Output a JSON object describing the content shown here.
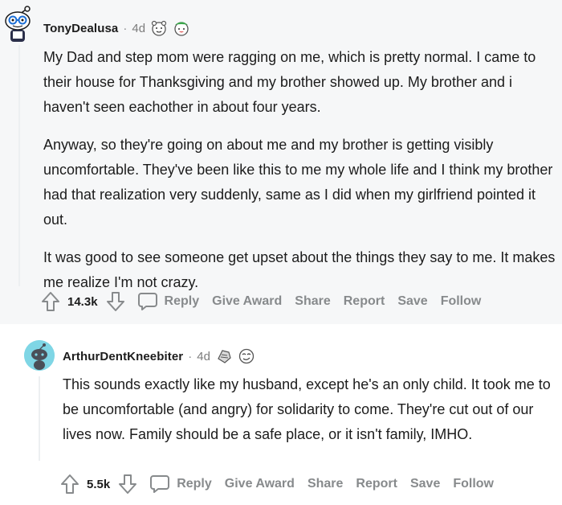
{
  "comments": [
    {
      "username": "TonyDealusa",
      "age": "4d",
      "paragraphs": [
        "My Dad and step mom were ragging on me, which is pretty normal. I came to their house for Thanksgiving and my brother showed up. My brother and i haven't seen eachother in about four years.",
        "Anyway, so they're going on about me and my brother is getting visibly uncomfortable. They've been like this to me my whole life and I think my brother had that realization very suddenly, same as I did when my girlfriend pointed it out.",
        "It was good to see someone get upset about the things they say to me. It makes me realize I'm not crazy."
      ],
      "score": "14.3k",
      "actions": {
        "reply": "Reply",
        "give_award": "Give Award",
        "share": "Share",
        "report": "Report",
        "save": "Save",
        "follow": "Follow"
      }
    },
    {
      "username": "ArthurDentKneebiter",
      "age": "4d",
      "paragraphs": [
        "This sounds exactly like my husband, except he's an only child. It took me to be uncomfortable (and angry) for solidarity to come. They're cut out of our lives now. Family should be a safe place, or it isn't family, IMHO."
      ],
      "score": "5.5k",
      "actions": {
        "reply": "Reply",
        "give_award": "Give Award",
        "share": "Share",
        "report": "Report",
        "save": "Save",
        "follow": "Follow"
      }
    }
  ],
  "separator": "·",
  "icons": {
    "upvote": "upvote-arrow-icon",
    "downvote": "downvote-arrow-icon",
    "reply": "speech-bubble-icon"
  }
}
